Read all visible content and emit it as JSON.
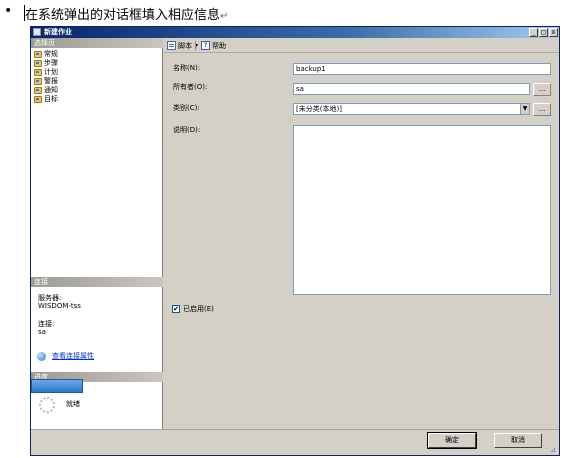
{
  "caption": {
    "bullet": "•",
    "text": "在系统弹出的对话框填入相应信息",
    "return_mark": "↵"
  },
  "window": {
    "title": "新建作业",
    "controls": {
      "minimize": "_",
      "maximize": "□",
      "close": "x"
    }
  },
  "left_pane": {
    "select_page_header": "选择页",
    "items": [
      {
        "label": "常规",
        "icon": "page-icon"
      },
      {
        "label": "步骤",
        "icon": "page-icon"
      },
      {
        "label": "计划",
        "icon": "page-icon"
      },
      {
        "label": "警报",
        "icon": "page-icon"
      },
      {
        "label": "通知",
        "icon": "page-icon"
      },
      {
        "label": "目标",
        "icon": "page-icon"
      }
    ],
    "connection_header": "连接",
    "server_label": "服务器:",
    "server_value": "WISDOM-tss",
    "connection_label": "连接:",
    "connection_value": "sa",
    "view_connection_link": "查看连接属性",
    "progress_header": "进度",
    "progress_status": "就绪"
  },
  "toolbar": {
    "script_label": "脚本",
    "help_label": "帮助"
  },
  "form": {
    "name_label": "名称(N):",
    "name_value": "backup1",
    "owner_label": "所有者(O):",
    "owner_value": "sa",
    "category_label": "类别(C):",
    "category_value": "[未分类(本地)]",
    "description_label": "说明(D):",
    "description_value": "",
    "ellipsis": "...",
    "enabled_label": "已启用(E)",
    "enabled_checked": true,
    "check_mark": "✔"
  },
  "footer": {
    "ok_label": "确定",
    "cancel_label": "取消",
    "grip": "⊿"
  }
}
